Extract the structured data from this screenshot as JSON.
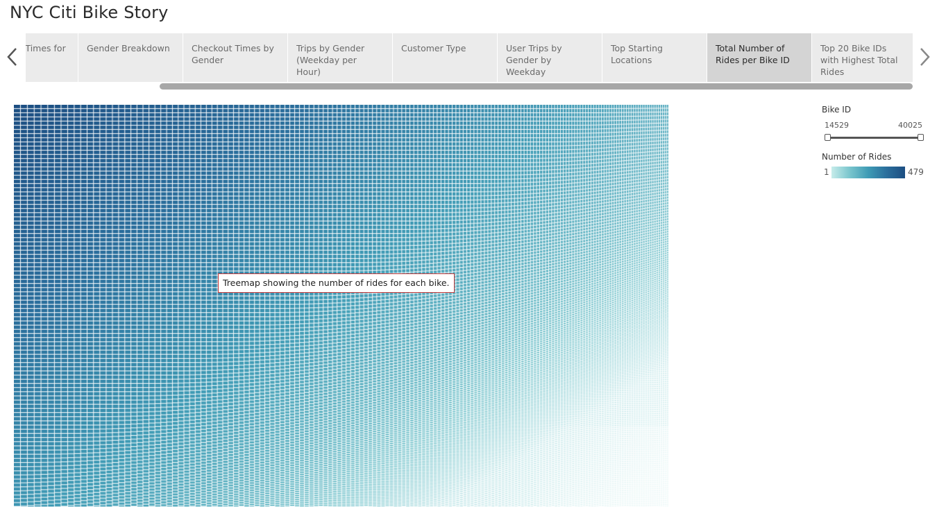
{
  "story": {
    "title": "NYC Citi Bike Story"
  },
  "nav": {
    "prev_icon": "chevron-left-icon",
    "next_icon": "chevron-right-icon"
  },
  "tabs": [
    {
      "label": "Checkout Times for",
      "active": false
    },
    {
      "label": "Gender Breakdown",
      "active": false
    },
    {
      "label": "Checkout Times by Gender",
      "active": false
    },
    {
      "label": "Trips by Gender (Weekday per Hour)",
      "active": false
    },
    {
      "label": "Customer Type",
      "active": false
    },
    {
      "label": "User Trips by Gender by Weekday",
      "active": false
    },
    {
      "label": "Top Starting Locations",
      "active": false
    },
    {
      "label": "Total Number of Rides per Bike ID",
      "active": true
    },
    {
      "label": "Top 20 Bike IDs with Highest Total Rides",
      "active": false
    }
  ],
  "caption": "Treemap showing the number of rides for each bike.",
  "filter": {
    "title": "Bike ID",
    "min": "14529",
    "max": "40025"
  },
  "legend": {
    "title": "Number of Rides",
    "min": "1",
    "max": "479",
    "colors": [
      "#c6ecea",
      "#79c5cd",
      "#3f9bb5",
      "#2a6e9c",
      "#1c4e82"
    ]
  },
  "chart_data": {
    "type": "heatmap",
    "description_type": "treemap",
    "measure": "Number of Rides",
    "dimension": "Bike ID",
    "color_range": [
      1,
      479
    ],
    "bike_id_range": [
      14529,
      40025
    ],
    "color_low": "#c6ecea",
    "color_high": "#1c4e82"
  }
}
